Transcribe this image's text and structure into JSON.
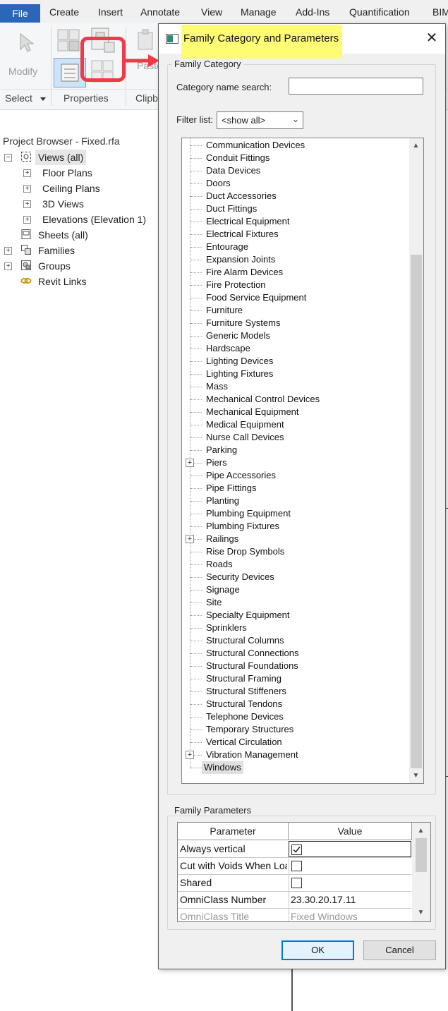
{
  "ribbon": {
    "file_tab": "File",
    "menus": [
      "Create",
      "Insert",
      "Annotate",
      "View",
      "Manage",
      "Add-Ins",
      "Quantification",
      "BIM"
    ],
    "modify_label": "Modify",
    "paste_label": "Paste",
    "panels": {
      "select": "Select",
      "properties": "Properties",
      "clipboard": "Clipb"
    }
  },
  "project_browser": {
    "title": "Project Browser - Fixed.rfa",
    "items": [
      {
        "label": "Views (all)",
        "expanded": true
      },
      {
        "label": "Floor Plans"
      },
      {
        "label": "Ceiling Plans"
      },
      {
        "label": "3D Views"
      },
      {
        "label": "Elevations (Elevation 1)"
      },
      {
        "label": "Sheets (all)"
      },
      {
        "label": "Families"
      },
      {
        "label": "Groups"
      },
      {
        "label": "Revit Links"
      }
    ]
  },
  "dialog": {
    "title": "Family Category and Parameters",
    "family_category_group": "Family Category",
    "category_search_label": "Category name search:",
    "category_search_value": "",
    "filter_label": "Filter list:",
    "filter_value": "<show all>",
    "categories": [
      "Communication Devices",
      "Conduit Fittings",
      "Data Devices",
      "Doors",
      "Duct Accessories",
      "Duct Fittings",
      "Electrical Equipment",
      "Electrical Fixtures",
      "Entourage",
      "Expansion Joints",
      "Fire Alarm Devices",
      "Fire Protection",
      "Food Service Equipment",
      "Furniture",
      "Furniture Systems",
      "Generic Models",
      "Hardscape",
      "Lighting Devices",
      "Lighting Fixtures",
      "Mass",
      "Mechanical Control Devices",
      "Mechanical Equipment",
      "Medical Equipment",
      "Nurse Call Devices",
      "Parking",
      "Piers",
      "Pipe Accessories",
      "Pipe Fittings",
      "Planting",
      "Plumbing Equipment",
      "Plumbing Fixtures",
      "Railings",
      "Rise Drop Symbols",
      "Roads",
      "Security Devices",
      "Signage",
      "Site",
      "Specialty Equipment",
      "Sprinklers",
      "Structural Columns",
      "Structural Connections",
      "Structural Foundations",
      "Structural Framing",
      "Structural Stiffeners",
      "Structural Tendons",
      "Telephone Devices",
      "Temporary Structures",
      "Vertical Circulation",
      "Vibration Management",
      "Windows"
    ],
    "expandable_categories": [
      "Piers",
      "Railings",
      "Vibration Management"
    ],
    "selected_category": "Windows",
    "family_parameters_group": "Family Parameters",
    "param_headers": {
      "parameter": "Parameter",
      "value": "Value"
    },
    "parameters": [
      {
        "name": "Always vertical",
        "value": "",
        "checkbox": true,
        "checked": true
      },
      {
        "name": "Cut with Voids When Loaded",
        "value": "",
        "checkbox": true,
        "checked": false
      },
      {
        "name": "Shared",
        "value": "",
        "checkbox": true,
        "checked": false
      },
      {
        "name": "OmniClass Number",
        "value": "23.30.20.17.11",
        "checkbox": false
      },
      {
        "name": "OmniClass Title",
        "value": "Fixed Windows",
        "checkbox": false
      }
    ],
    "ok_label": "OK",
    "cancel_label": "Cancel"
  },
  "colors": {
    "file_tab": "#2b66b8",
    "title_highlight": "#fdfc73",
    "callout": "#f03a47",
    "ok_border": "#0078d7"
  }
}
